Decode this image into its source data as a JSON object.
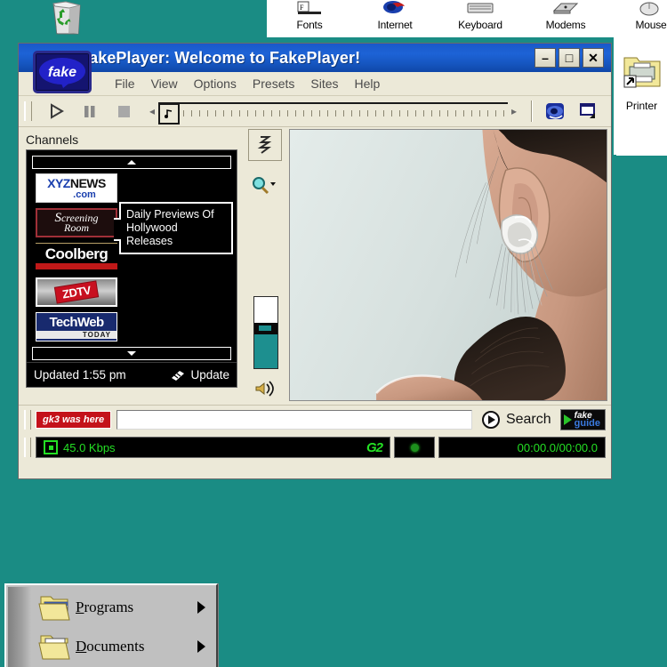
{
  "desktop": {
    "background_color": "#1a8c84",
    "recycle_bin": {
      "name": "recycle-bin"
    },
    "printers": {
      "label": "Printer"
    },
    "control_panel": {
      "items": [
        {
          "label": "Fonts",
          "icon": "fonts-icon"
        },
        {
          "label": "Internet",
          "icon": "internet-icon"
        },
        {
          "label": "Keyboard",
          "icon": "keyboard-icon"
        },
        {
          "label": "Modems",
          "icon": "modems-icon"
        },
        {
          "label": "Mouse",
          "icon": "mouse-icon"
        }
      ]
    }
  },
  "start_menu": {
    "items": [
      {
        "label": "Programs",
        "accel": "P",
        "icon": "programs-folder-icon",
        "has_submenu": true
      },
      {
        "label": "Documents",
        "accel": "D",
        "icon": "documents-folder-icon",
        "has_submenu": true
      }
    ]
  },
  "player": {
    "title": "FakePlayer: Welcome to FakePlayer!",
    "logo_text": "fake",
    "window_buttons": {
      "minimize": "–",
      "maximize": "□",
      "close": "✕"
    },
    "menu": [
      "File",
      "View",
      "Options",
      "Presets",
      "Sites",
      "Help"
    ],
    "toolbar": {
      "play": "play-button",
      "pause": "pause-button",
      "stop": "stop-button",
      "seek_prev": "◂",
      "seek_next": "▸",
      "seek_thumb_label": "♪",
      "browser_button": "internet-button",
      "resize_button": "window-resize-button"
    },
    "channels": {
      "title": "Channels",
      "scroll_up": "scroll-up",
      "scroll_down": "scroll-down",
      "items": [
        {
          "name": "XYZNEWS.com",
          "line1_a": "XYZ",
          "line1_b": "NEWS",
          "line2": ".com"
        },
        {
          "name": "Screening Room",
          "line1": "S",
          "line1_rest": "creening",
          "line2": "Room"
        },
        {
          "name": "Coolberg",
          "text": "Coolberg"
        },
        {
          "name": "ZDTV",
          "text": "ZDTV"
        },
        {
          "name": "TechWeb TODAY",
          "line1": "TechWeb",
          "line2": "TODAY"
        }
      ],
      "tooltip": "Daily Previews Of Hollywood Releases",
      "updated_text": "Updated 1:55 pm",
      "update_button": "Update"
    },
    "side_controls": {
      "collapse": "collapse-panel",
      "zoom": "zoom-dropdown",
      "volume": "volume-slider",
      "mute": "mute-icon"
    },
    "video": {
      "description": "video-display"
    },
    "search": {
      "badge": "gk3 was here",
      "value": "",
      "placeholder": "",
      "button_label": "Search",
      "guide_line1": "fake",
      "guide_line2": "guide"
    },
    "status": {
      "bitrate": "45.0 Kbps",
      "codec": "G2",
      "record_indicator": "record-dot",
      "time": "00:00.0/00:00.0"
    }
  }
}
